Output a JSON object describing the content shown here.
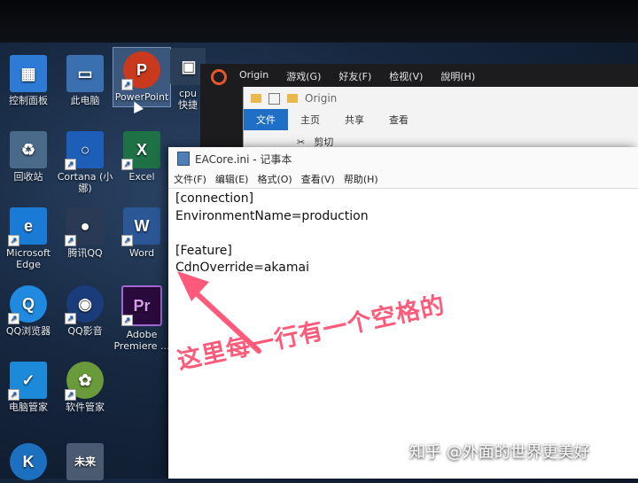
{
  "desktop": {
    "icons": [
      {
        "label": "控制面板",
        "color": "#2d7bd4",
        "glyph": "▦"
      },
      {
        "label": "此电脑",
        "color": "#3a6fb0",
        "glyph": "▭"
      },
      {
        "label": "PowerPoint",
        "color": "#c8391e",
        "glyph": "P"
      },
      {
        "label": "cpu\n快捷",
        "color": "#2b3e58",
        "glyph": "▣"
      },
      {
        "label": "回收站",
        "color": "#4a6a8a",
        "glyph": "♻"
      },
      {
        "label": "Cortana (小\n娜)",
        "color": "#1d5fb8",
        "glyph": "○"
      },
      {
        "label": "Excel",
        "color": "#1e7145",
        "glyph": "X"
      },
      {
        "label": "Microsoft\nEdge",
        "color": "#1a7bd6",
        "glyph": "e"
      },
      {
        "label": "腾讯QQ",
        "color": "#2a3a55",
        "glyph": "🐧"
      },
      {
        "label": "Word",
        "color": "#2b5797",
        "glyph": "W"
      },
      {
        "label": "QQ浏览器",
        "color": "#1f8ae0",
        "glyph": "Q"
      },
      {
        "label": "QQ影音",
        "color": "#1b3c7a",
        "glyph": "◉"
      },
      {
        "label": "Adobe\nPremiere ...",
        "color": "#2a0a3c",
        "glyph": "Pr"
      },
      {
        "label": "电脑管家",
        "color": "#1c8ad9",
        "glyph": "✓"
      },
      {
        "label": "软件管家",
        "color": "#6a9a3a",
        "glyph": "✿"
      },
      {
        "label": "",
        "color": "#1d6fc0",
        "glyph": "K"
      },
      {
        "label": "",
        "color": "#4a5a70",
        "glyph": "未来"
      }
    ]
  },
  "origin_window": {
    "menu": [
      "Origin",
      "游戏(G)",
      "好友(F)",
      "检视(V)",
      "說明(H)"
    ]
  },
  "explorer": {
    "title": "Origin",
    "tabs": [
      "文件",
      "主页",
      "共享",
      "查看"
    ],
    "tool": "剪切"
  },
  "notepad": {
    "title": "EACore.ini - 记事本",
    "menu": [
      "文件(F)",
      "编辑(E)",
      "格式(O)",
      "查看(V)",
      "帮助(H)"
    ],
    "lines": [
      "[connection]",
      "EnvironmentName=production",
      "",
      "[Feature]",
      "CdnOverride=akamai"
    ]
  },
  "annotation": {
    "text": "这里每一行有一个空格的",
    "color": "#ff5a7a"
  },
  "watermark": "知乎 @外面的世界更美好"
}
